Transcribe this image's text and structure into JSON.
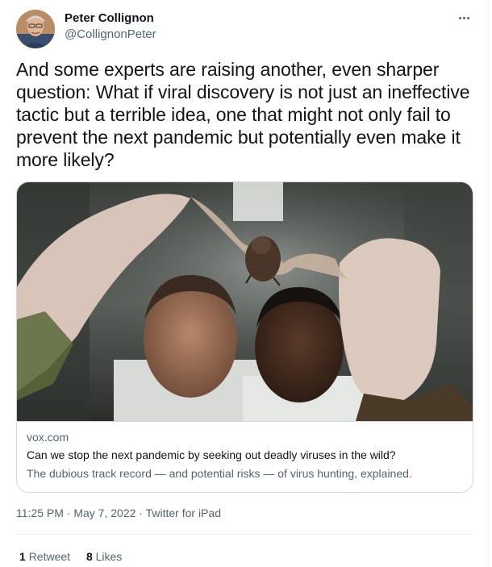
{
  "author": {
    "display_name": "Peter Collignon",
    "handle": "@CollignonPeter"
  },
  "tweet": {
    "text": "And some experts are raising another, even sharper question: What if viral discovery is not just an ineffective tactic but a terrible idea, one that might not only fail to prevent the next pandemic but potentially even make it more likely?"
  },
  "card": {
    "domain": "vox.com",
    "title": "Can we stop the next pandemic by seeking out deadly viruses in the wild?",
    "description": "The dubious track record — and potential risks — of virus hunting, explained."
  },
  "meta": {
    "time": "11:25 PM",
    "separator": "·",
    "date": "May 7, 2022",
    "source": "Twitter for iPad"
  },
  "stats": {
    "retweets_count": "1",
    "retweets_label": "Retweet",
    "likes_count": "8",
    "likes_label": "Likes"
  },
  "colors": {
    "text_primary": "#0f1419",
    "text_secondary": "#536471",
    "border": "#cfd9de"
  }
}
